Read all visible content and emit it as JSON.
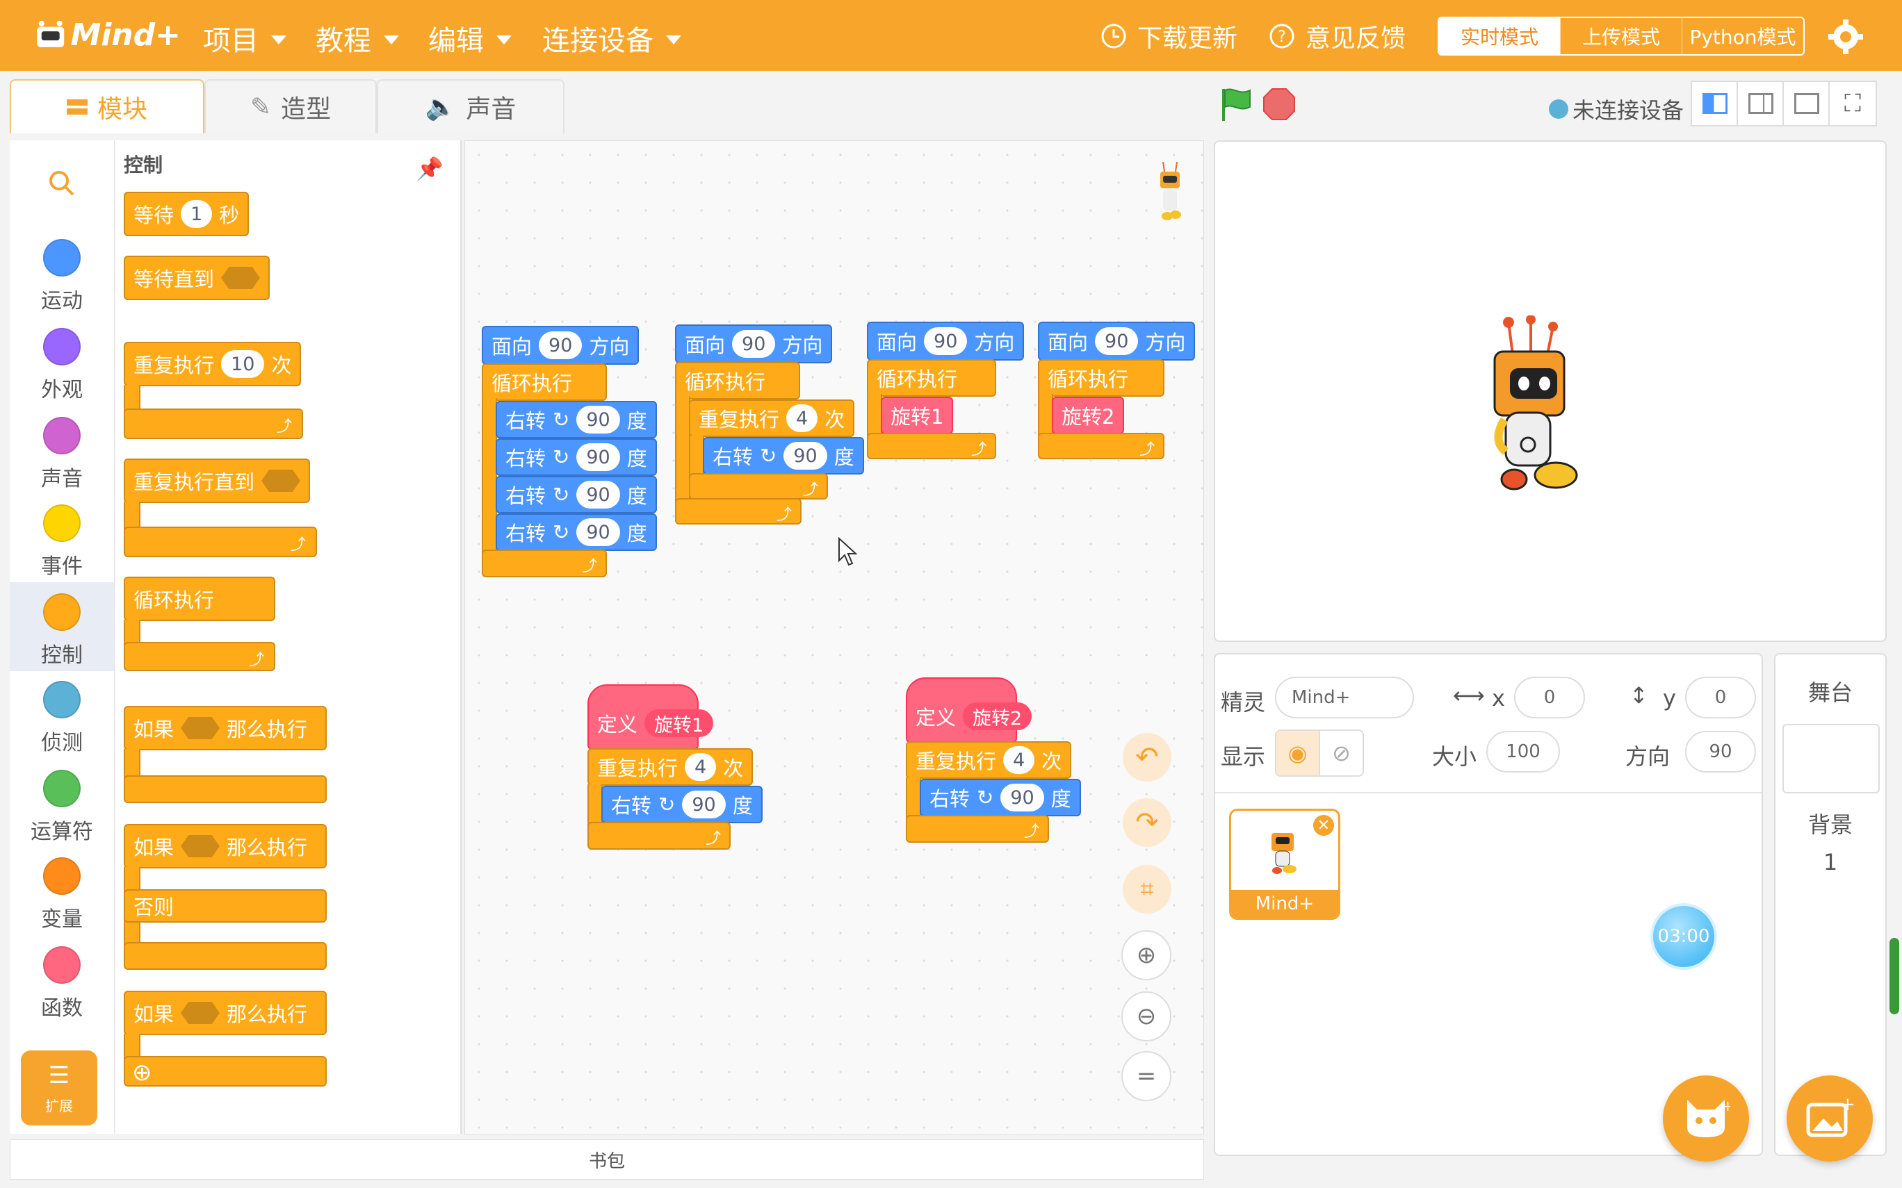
{
  "topbar": {
    "logo_text": "Mind+",
    "menus": [
      "项目",
      "教程",
      "编辑",
      "连接设备"
    ],
    "download_update": "下载更新",
    "feedback": "意见反馈",
    "modes": [
      "实时模式",
      "上传模式",
      "Python模式"
    ]
  },
  "tabs": [
    "模块",
    "造型",
    "声音"
  ],
  "categories": [
    "运动",
    "外观",
    "声音",
    "事件",
    "控制",
    "侦测",
    "运算符",
    "变量",
    "函数"
  ],
  "category_colors": [
    "#4c97ff",
    "#9966ff",
    "#cf63cf",
    "#ffd500",
    "#ffab19",
    "#5cb1d6",
    "#59c059",
    "#ff8c1a",
    "#ff6680"
  ],
  "extension_label": "扩展",
  "palette": {
    "title": "控制",
    "wait": {
      "text": "等待",
      "value": "1",
      "unit": "秒"
    },
    "wait_until": "等待直到",
    "repeat": {
      "text": "重复执行",
      "value": "10",
      "unit": "次"
    },
    "repeat_until": "重复执行直到",
    "forever": "循环执行",
    "if_then": {
      "if": "如果",
      "then": "那么执行"
    },
    "else": "否则"
  },
  "scripts": {
    "face": {
      "text": "面向",
      "value": "90",
      "unit": "方向"
    },
    "forever": "循环执行",
    "turn": {
      "text": "右转",
      "value": "90",
      "unit": "度"
    },
    "repeat": {
      "text": "重复执行",
      "value": "4",
      "unit": "次"
    },
    "call1": "旋转1",
    "call2": "旋转2",
    "define": "定义"
  },
  "toolbar": {
    "status": "未连接设备"
  },
  "sprite": {
    "label": "精灵",
    "name": "Mind+",
    "x_label": "x",
    "x": "0",
    "y_label": "y",
    "y": "0",
    "show_label": "显示",
    "size_label": "大小",
    "size": "100",
    "direction_label": "方向",
    "direction": "90",
    "thumb_label": "Mind+"
  },
  "stage_panel": {
    "title": "舞台",
    "backdrop_label": "背景",
    "backdrop_count": "1"
  },
  "timer": "03:00",
  "bag": "书包"
}
